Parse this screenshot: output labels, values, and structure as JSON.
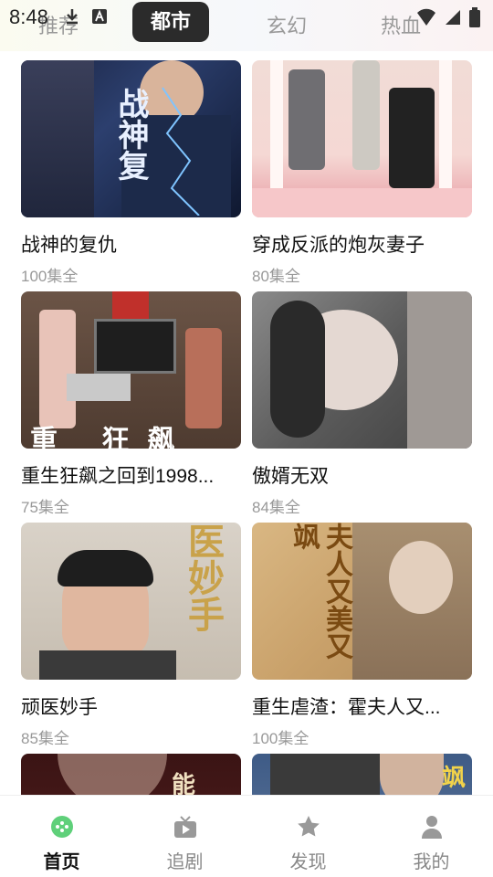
{
  "status": {
    "time": "8:48"
  },
  "tabs": [
    {
      "label": "推荐"
    },
    {
      "label": "都市"
    },
    {
      "label": "玄幻"
    },
    {
      "label": "热血"
    }
  ],
  "cards": [
    {
      "title": "战神的复仇",
      "episodes": "100集全",
      "thumb_text": "战神复"
    },
    {
      "title": "穿成反派的炮灰妻子",
      "episodes": "80集全",
      "thumb_text": ""
    },
    {
      "title": "重生狂飙之回到1998...",
      "episodes": "75集全",
      "thumb_text": "重 狂飙"
    },
    {
      "title": "傲婿无双",
      "episodes": "84集全",
      "thumb_text": ""
    },
    {
      "title": "顽医妙手",
      "episodes": "85集全",
      "thumb_text": "医妙手"
    },
    {
      "title": "重生虐渣：霍夫人又...",
      "episodes": "100集全",
      "thumb_text": "夫人又美又飒"
    },
    {
      "title": "",
      "episodes": "",
      "thumb_text": "能"
    },
    {
      "title": "",
      "episodes": "",
      "thumb_text": "飒"
    }
  ],
  "bottom_nav": [
    {
      "label": "首页",
      "icon": "home-icon"
    },
    {
      "label": "追剧",
      "icon": "tv-icon"
    },
    {
      "label": "发现",
      "icon": "star-icon"
    },
    {
      "label": "我的",
      "icon": "user-icon"
    }
  ],
  "colors": {
    "accent": "#5fd07a",
    "tab_active_bg": "#2b2b2b"
  }
}
